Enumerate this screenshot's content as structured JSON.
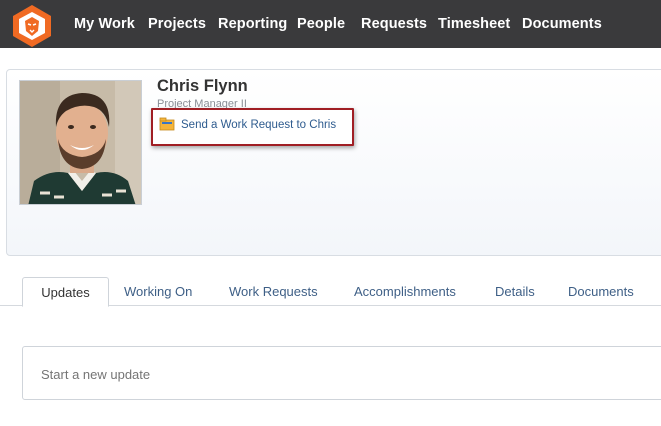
{
  "nav": {
    "logo_icon": "lion-logo-icon",
    "items": [
      "My Work",
      "Projects",
      "Reporting",
      "People",
      "Requests",
      "Timesheet",
      "Documents"
    ]
  },
  "profile": {
    "name": "Chris Flynn",
    "role": "Project Manager II",
    "request_link": "Send a Work Request to Chris",
    "request_icon": "folder-request-icon"
  },
  "tabs": {
    "active": "Updates",
    "items": [
      "Updates",
      "Working On",
      "Work Requests",
      "Accomplishments",
      "Details",
      "Documents"
    ]
  },
  "update": {
    "placeholder": "Start a new update"
  },
  "colors": {
    "nav_bg": "#3a3a3c",
    "logo_orange": "#f06a23",
    "link_blue": "#2f5c8f",
    "highlight_red": "#a01e24"
  }
}
